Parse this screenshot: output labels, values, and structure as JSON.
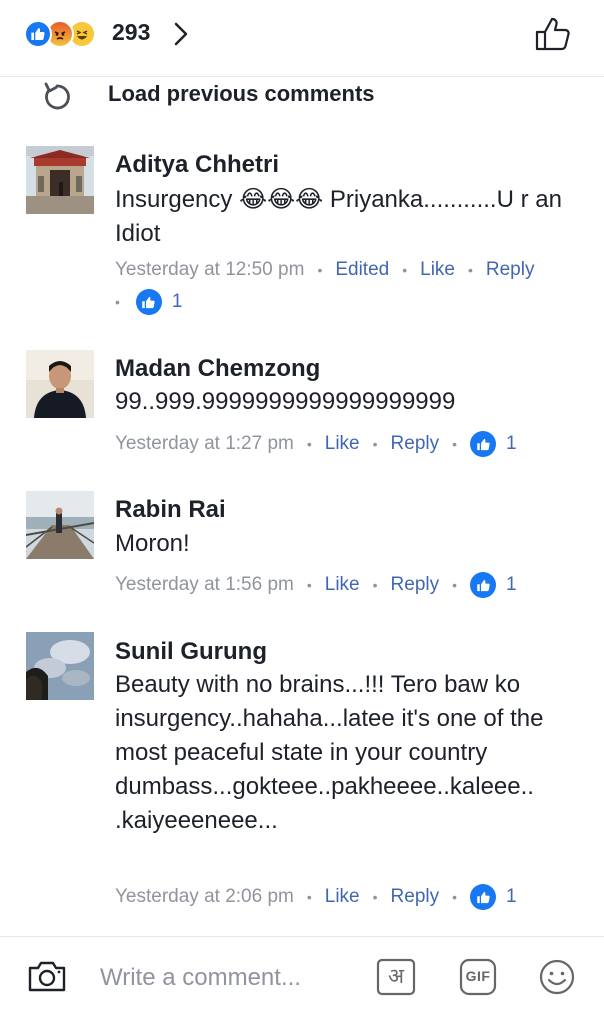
{
  "reactions": {
    "types": [
      "like-icon",
      "angry-icon",
      "haha-icon"
    ],
    "count": "293"
  },
  "load_previous": {
    "label": "Load previous comments"
  },
  "comments": [
    {
      "name": "Aditya Chhetri",
      "text": "Insurgency 😂😂😂 Priyanka...........U r an Idiot",
      "time": "Yesterday at 12:50 pm",
      "edited": "Edited",
      "like": "Like",
      "reply": "Reply",
      "likes": "1"
    },
    {
      "name": "Madan Chemzong",
      "text": "99..999.9999999999999999999",
      "time": "Yesterday at 1:27 pm",
      "like": "Like",
      "reply": "Reply",
      "likes": "1"
    },
    {
      "name": "Rabin Rai",
      "text": "Moron!",
      "time": "Yesterday at 1:56 pm",
      "like": "Like",
      "reply": "Reply",
      "likes": "1"
    },
    {
      "name": "Sunil Gurung",
      "text": "Beauty with no brains...!!! Tero baw ko insurgency..hahaha...latee it's one of the most peaceful state in your country dumbass...gokteee..pakheeee..kaleee.. .kaiyeeeneee...",
      "time": "Yesterday at 2:06 pm",
      "like": "Like",
      "reply": "Reply",
      "likes": "1"
    }
  ],
  "composer": {
    "placeholder": "Write a comment...",
    "hindi_label": "अ",
    "gif_label": "GIF"
  },
  "colors": {
    "accent": "#1877f2",
    "link": "#4267b2",
    "muted": "#90949c"
  }
}
